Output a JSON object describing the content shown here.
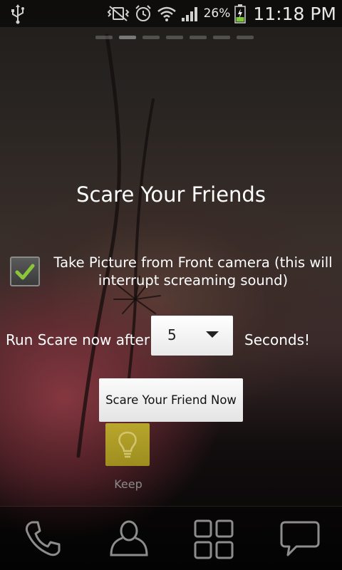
{
  "status_bar": {
    "icons": [
      "usb-icon",
      "mute-vibrate-icon",
      "alarm-icon",
      "wifi-icon",
      "signal-icon",
      "battery-charging-icon"
    ],
    "battery_percent": "26%",
    "time": "11:18 PM"
  },
  "home": {
    "pages": 7,
    "active_page": 1
  },
  "widget": {
    "title": "Scare Your Friends",
    "camera_checkbox": {
      "checked": true,
      "label": "Take Picture from Front camera (this will interrupt screaming sound)"
    },
    "run_label": "Run Scare now after",
    "delay_select": {
      "value": "5"
    },
    "seconds_label": "Seconds!",
    "scare_button_label": "Scare Your Friend Now"
  },
  "apps": [
    {
      "name": "Keep",
      "icon": "lightbulb-icon",
      "color": "#c9bd2d"
    }
  ],
  "dock": [
    {
      "name": "phone",
      "icon": "phone-icon"
    },
    {
      "name": "contacts",
      "icon": "contacts-icon"
    },
    {
      "name": "apps",
      "icon": "apps-grid-icon"
    },
    {
      "name": "messaging",
      "icon": "message-icon"
    }
  ],
  "colors": {
    "checkmark": "#8ac53a",
    "text": "#ffffff",
    "keep_tile": "#c9bd2d"
  }
}
